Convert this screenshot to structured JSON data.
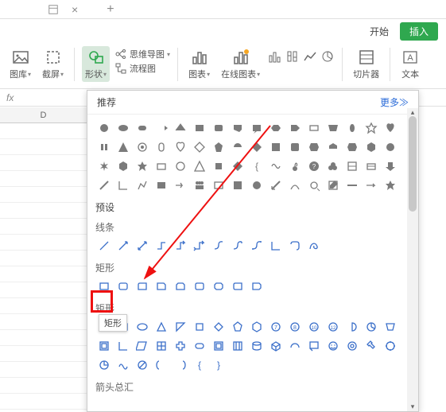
{
  "titlebar": {
    "close": "×",
    "plus": "+"
  },
  "tabs": {
    "start": "开始",
    "insert": "插入"
  },
  "ribbon": {
    "gallery": "图库",
    "screenshot": "截屏",
    "shapes": "形状",
    "mindmap": "思维导图",
    "flowchart": "流程图",
    "chart": "图表",
    "onlinechart": "在线图表",
    "slicer": "切片器",
    "textbox": "文本"
  },
  "panel": {
    "recommend": "推荐",
    "more": "更多≫",
    "preset": "预设",
    "lines": "线条",
    "rect": "矩形",
    "arrows_summary": "箭头总汇"
  },
  "tooltip": "矩形",
  "column_header": "D",
  "chart_data": null
}
